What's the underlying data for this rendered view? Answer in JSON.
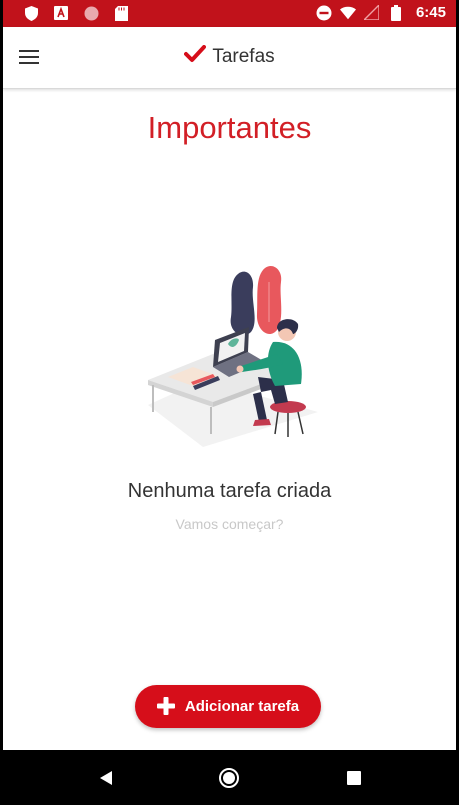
{
  "status_bar": {
    "time": "6:45",
    "left_icons": [
      "shield-icon",
      "a-box-icon",
      "circle-icon",
      "sd-card-icon"
    ],
    "right_icons": [
      "do-not-disturb-icon",
      "wifi-icon",
      "signal-icon",
      "battery-icon"
    ],
    "color": "#c1121b"
  },
  "app_bar": {
    "title": "Tarefas",
    "title_icon": "checkmark-icon",
    "menu_icon": "hamburger-menu-icon"
  },
  "page": {
    "title": "Importantes",
    "accent_color": "#d21f26"
  },
  "empty_state": {
    "illustration": "person-working-at-desk-illustration",
    "title": "Nenhuma tarefa criada",
    "subtitle": "Vamos começar?"
  },
  "add_button": {
    "label": "Adicionar tarefa",
    "icon": "plus-icon",
    "color": "#d60e1a"
  },
  "nav_bar": {
    "buttons": [
      "back-icon",
      "home-icon",
      "recents-icon"
    ]
  }
}
